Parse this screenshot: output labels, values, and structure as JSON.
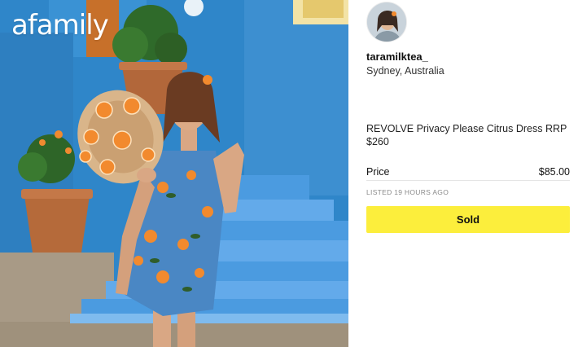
{
  "brand": {
    "logo_text": "afamily"
  },
  "seller": {
    "username": "taramilktea_",
    "location": "Sydney, Australia"
  },
  "listing": {
    "title": "REVOLVE Privacy Please Citrus Dress RRP $260",
    "price_label": "Price",
    "price_value": "$85.00",
    "listed_text": "LISTED 19 HOURS AGO",
    "status_button": "Sold"
  },
  "colors": {
    "wall_blue": "#2f86c9",
    "button_yellow": "#fcee3c",
    "dress_blue": "#4a87c4",
    "citrus_orange": "#f28a2e"
  }
}
